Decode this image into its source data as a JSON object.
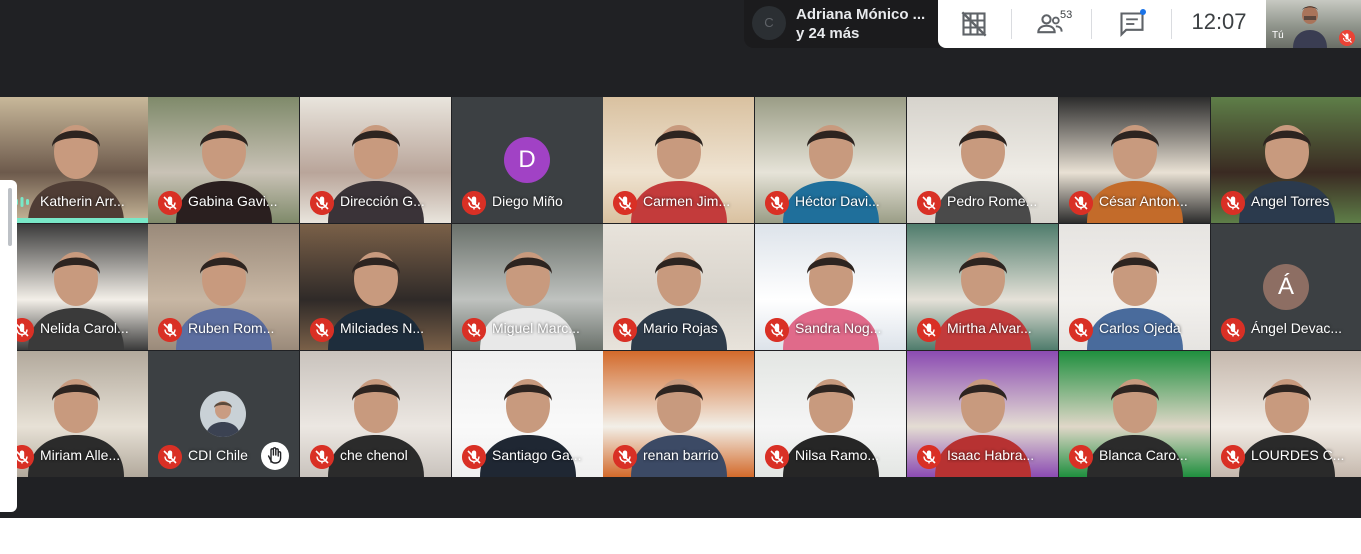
{
  "presenter": {
    "avatar_letter": "C",
    "name": "Adriana Mónico ...",
    "more": "y 24 más"
  },
  "toolbar": {
    "participants_count": "53",
    "time": "12:07",
    "icons": [
      "grid-layout-icon",
      "people-icon",
      "chat-icon"
    ]
  },
  "self_view": {
    "label": "Tú"
  },
  "participants": [
    {
      "name": "Katherin Arr...",
      "muted": false,
      "speaking": true
    },
    {
      "name": "Gabina Gavi...",
      "muted": true
    },
    {
      "name": "Dirección G...",
      "muted": true
    },
    {
      "name": "Diego Miño",
      "muted": true,
      "avatar_letter": "D",
      "avatar_color": "#a142c5"
    },
    {
      "name": "Carmen Jim...",
      "muted": true
    },
    {
      "name": "Héctor Davi...",
      "muted": true
    },
    {
      "name": "Pedro Rome...",
      "muted": true
    },
    {
      "name": "César Anton...",
      "muted": true
    },
    {
      "name": "Angel Torres",
      "muted": true
    },
    {
      "name": "Nelida Carol...",
      "muted": true
    },
    {
      "name": "Ruben Rom...",
      "muted": true
    },
    {
      "name": "Milciades N...",
      "muted": true
    },
    {
      "name": "Miguel Marc...",
      "muted": true
    },
    {
      "name": "Mario Rojas",
      "muted": true
    },
    {
      "name": "Sandra Nog...",
      "muted": true
    },
    {
      "name": "Mirtha Alvar...",
      "muted": true
    },
    {
      "name": "Carlos Ojeda",
      "muted": true
    },
    {
      "name": "Ángel Devac...",
      "muted": true,
      "avatar_letter": "Á",
      "avatar_color": "#8d6e63"
    },
    {
      "name": "Miriam Alle...",
      "muted": true
    },
    {
      "name": "CDI Chile",
      "muted": true,
      "hand_raised": true
    },
    {
      "name": "che chenol",
      "muted": true
    },
    {
      "name": "Santiago Ga...",
      "muted": true
    },
    {
      "name": "renan barrio",
      "muted": true
    },
    {
      "name": "Nilsa Ramo...",
      "muted": true
    },
    {
      "name": "Isaac Habra...",
      "muted": true
    },
    {
      "name": "Blanca Caro...",
      "muted": true
    },
    {
      "name": "LOURDES C...",
      "muted": true
    }
  ]
}
